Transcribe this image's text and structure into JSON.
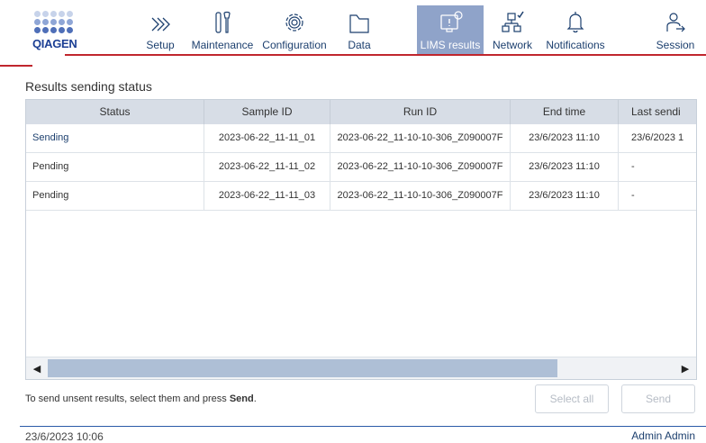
{
  "brand": {
    "logo_text": "QIAGEN",
    "accent_color": "#c0262d",
    "logo_color": "#1c3f94"
  },
  "nav": {
    "items": [
      {
        "label": "Setup",
        "icon": "chevrons-right-icon",
        "active": false
      },
      {
        "label": "Maintenance",
        "icon": "tools-icon",
        "active": false
      },
      {
        "label": "Configuration",
        "icon": "gear-icon",
        "active": false
      },
      {
        "label": "Data",
        "icon": "folder-icon",
        "active": false
      },
      {
        "label": "LIMS results",
        "icon": "lims-results-icon",
        "active": true
      },
      {
        "label": "Network",
        "icon": "network-icon",
        "active": false
      },
      {
        "label": "Notifications",
        "icon": "bell-icon",
        "active": false
      },
      {
        "label": "Session",
        "icon": "session-icon",
        "active": false
      }
    ]
  },
  "page": {
    "title": "Results sending status"
  },
  "table": {
    "columns": [
      "Status",
      "Sample ID",
      "Run ID",
      "End time",
      "Last sendi"
    ],
    "rows": [
      {
        "status": "Sending",
        "sample_id": "2023-06-22_11-11_01",
        "run_id": "2023-06-22_11-10-10-306_Z090007F",
        "end_time": "23/6/2023 11:10",
        "last_sending": "23/6/2023 1"
      },
      {
        "status": "Pending",
        "sample_id": "2023-06-22_11-11_02",
        "run_id": "2023-06-22_11-10-10-306_Z090007F",
        "end_time": "23/6/2023 11:10",
        "last_sending": "-"
      },
      {
        "status": "Pending",
        "sample_id": "2023-06-22_11-11_03",
        "run_id": "2023-06-22_11-10-10-306_Z090007F",
        "end_time": "23/6/2023 11:10",
        "last_sending": "-"
      }
    ]
  },
  "footer": {
    "instruction_prefix": "To send unsent results, select them and press ",
    "instruction_bold": "Send",
    "instruction_suffix": ".",
    "select_all_label": "Select all",
    "send_label": "Send"
  },
  "status_bar": {
    "date": "23/6/2023 10:06",
    "user": "Admin Admin"
  }
}
